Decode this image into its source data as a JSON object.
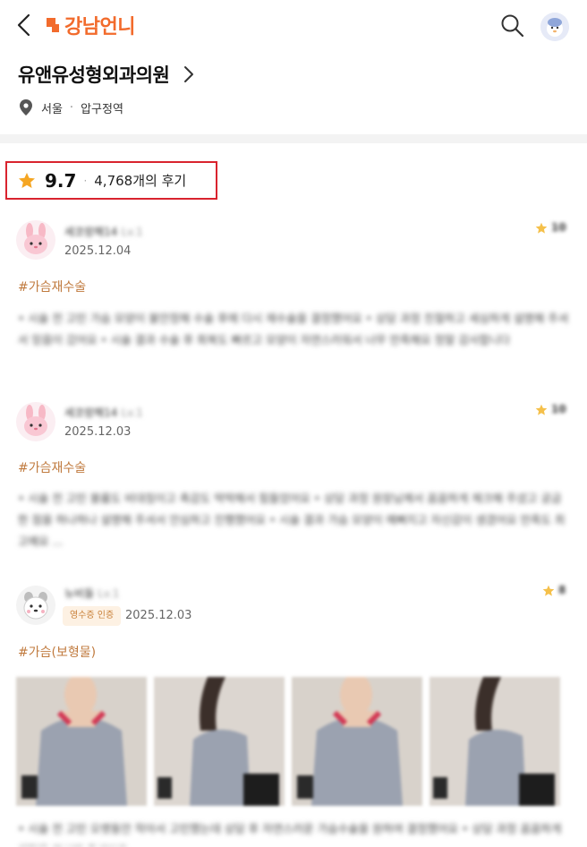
{
  "header": {
    "logo_text": "강남언니",
    "back_icon": "chevron-left-icon",
    "search_icon": "search-icon",
    "accent_color": "#f26b2c"
  },
  "hospital": {
    "name": "유앤유성형외과의원",
    "city": "서울",
    "area": "압구정역",
    "separator": "·"
  },
  "rating": {
    "value": "9.7",
    "separator": "·",
    "review_count": "4,768개의 후기"
  },
  "reviews": [
    {
      "name": "세코랑해14",
      "level": "Lv.1",
      "date": "2025.12.04",
      "score": "10",
      "tag": "#가슴재수술",
      "body": "• 시술 전 고민 가슴 모양이 불안정해 수술 후에 다시 재수술을 결정했어요 • 상담 과정 친절하고 세심하게 설명해 주셔서 믿음이 갔어요 • 시술 결과 수술 후 회복도 빠르고 모양이 자연스러워서 너무 만족해요 정말 감사합니다"
    },
    {
      "name": "세코랑해14",
      "level": "Lv.1",
      "date": "2025.12.03",
      "score": "10",
      "tag": "#가슴재수술",
      "body": "• 시술 전 고민 볼륨도 비대칭이고 촉감도 딱딱해서 힘들었어요 • 상담 과정 원장님께서 꼼꼼하게 체크해 주셨고 궁금한 점을 하나하나 설명해 주셔서 안심하고 진행했어요 • 시술 결과 가슴 모양이 예뻐지고 자신감이 생겼어요 만족도 최고예요 ..."
    },
    {
      "name": "뉴비들",
      "level": "Lv.1",
      "badge": "영수증 인증",
      "date": "2025.12.03",
      "score": "8",
      "tag": "#가슴(보형물)",
      "body": "• 시술 전 고민 오랫동안 작아서 고민했는데 상담 후 자연스러운 가슴수술을 원하여 결정했어요 • 상담 과정 꼼꼼하게 체형을 분석해 주셨어요"
    }
  ]
}
